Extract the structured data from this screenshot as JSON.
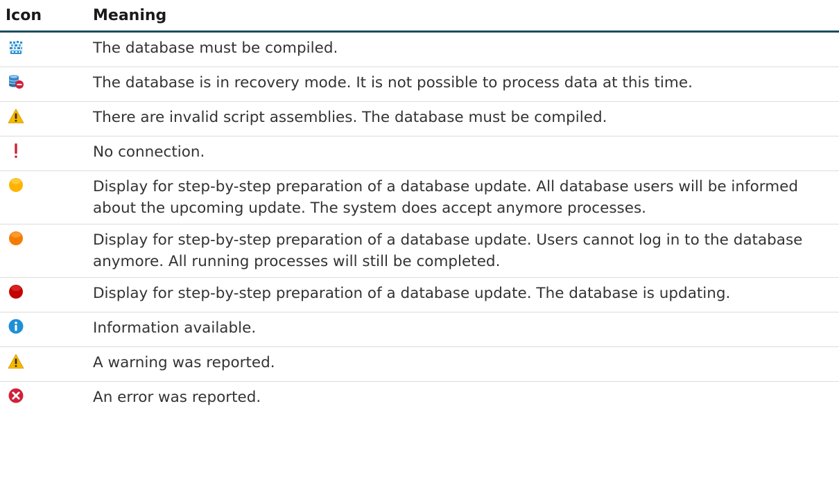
{
  "table": {
    "headers": {
      "icon": "Icon",
      "meaning": "Meaning"
    },
    "rows": [
      {
        "icon": "database-compile-icon",
        "meaning": "The database must be compiled."
      },
      {
        "icon": "database-recovery-icon",
        "meaning": "The database is in recovery mode. It is not possible to process data at this time."
      },
      {
        "icon": "warning-triangle-icon",
        "meaning": "There are invalid script assemblies. The database must be compiled."
      },
      {
        "icon": "exclamation-icon",
        "meaning": "No connection."
      },
      {
        "icon": "yellow-circle-icon",
        "meaning": "Display for step-by-step preparation of a database update. All database users will be informed about the upcoming update. The system does accept anymore processes."
      },
      {
        "icon": "orange-circle-icon",
        "meaning": "Display for step-by-step preparation of a database update. Users cannot log in to the database anymore. All running processes will still be completed."
      },
      {
        "icon": "red-circle-icon",
        "meaning": "Display for step-by-step preparation of a database update. The database is updating."
      },
      {
        "icon": "info-icon",
        "meaning": "Information available."
      },
      {
        "icon": "warning-triangle-icon",
        "meaning": "A warning was reported."
      },
      {
        "icon": "error-icon",
        "meaning": "An error was reported."
      }
    ]
  },
  "colors": {
    "header_rule": "#1d4d5f",
    "row_divider": "#dcdcdc",
    "warning": "#f5b800",
    "yellow_status": "#ffb300",
    "orange_status": "#f57c00",
    "red_status": "#c40000",
    "info": "#1e90d6",
    "error": "#d0213a"
  }
}
